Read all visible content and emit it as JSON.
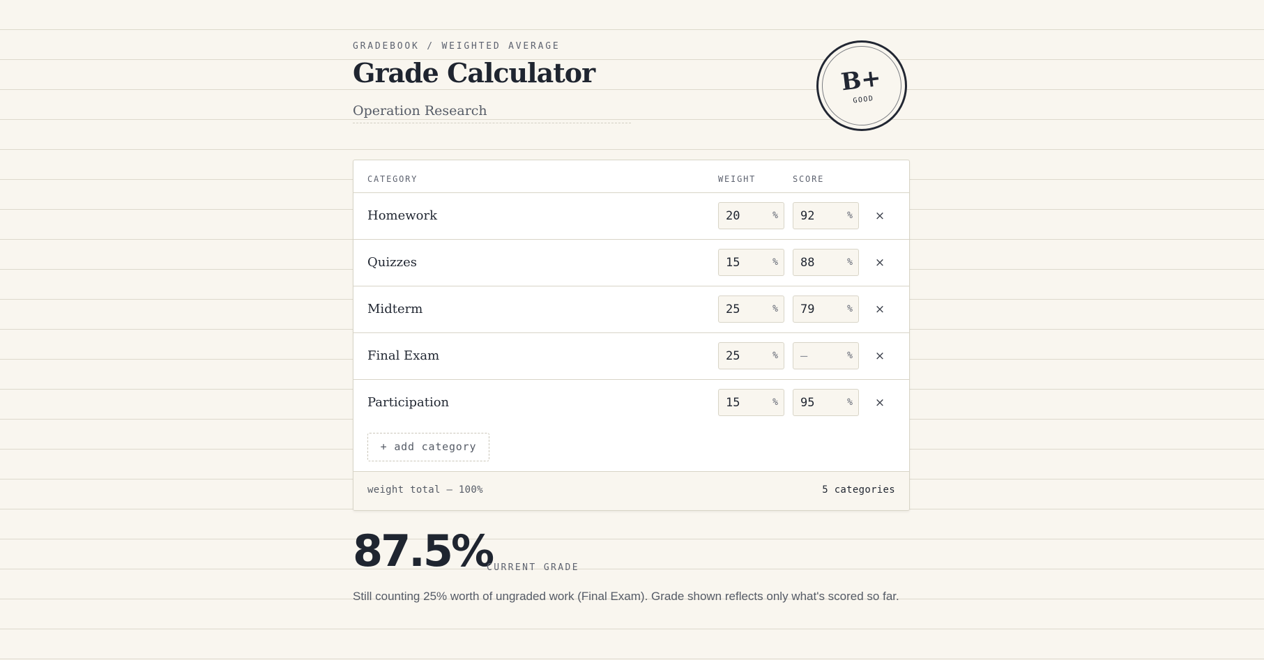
{
  "header": {
    "breadcrumb": "GRADEBOOK / WEIGHTED AVERAGE",
    "title": "Grade Calculator",
    "course": "Operation Research"
  },
  "seal": {
    "letter": "B+",
    "word": "GOOD"
  },
  "table": {
    "columns": {
      "category": "CATEGORY",
      "weight": "WEIGHT",
      "score": "SCORE"
    },
    "rows": [
      {
        "name": "Homework",
        "weight": "20",
        "score": "92"
      },
      {
        "name": "Quizzes",
        "weight": "15",
        "score": "88"
      },
      {
        "name": "Midterm",
        "weight": "25",
        "score": "79"
      },
      {
        "name": "Final Exam",
        "weight": "25",
        "score": "—"
      },
      {
        "name": "Participation",
        "weight": "15",
        "score": "95"
      }
    ],
    "unit": "%",
    "remove_glyph": "×",
    "add_label": "+ add category",
    "weight_total": "weight total — 100%",
    "category_count": "5 categories"
  },
  "result": {
    "grade": "87.5%",
    "label": "CURRENT GRADE",
    "note": "Still counting 25% worth of ungraded work (Final Exam). Grade shown reflects only what's scored so far."
  }
}
